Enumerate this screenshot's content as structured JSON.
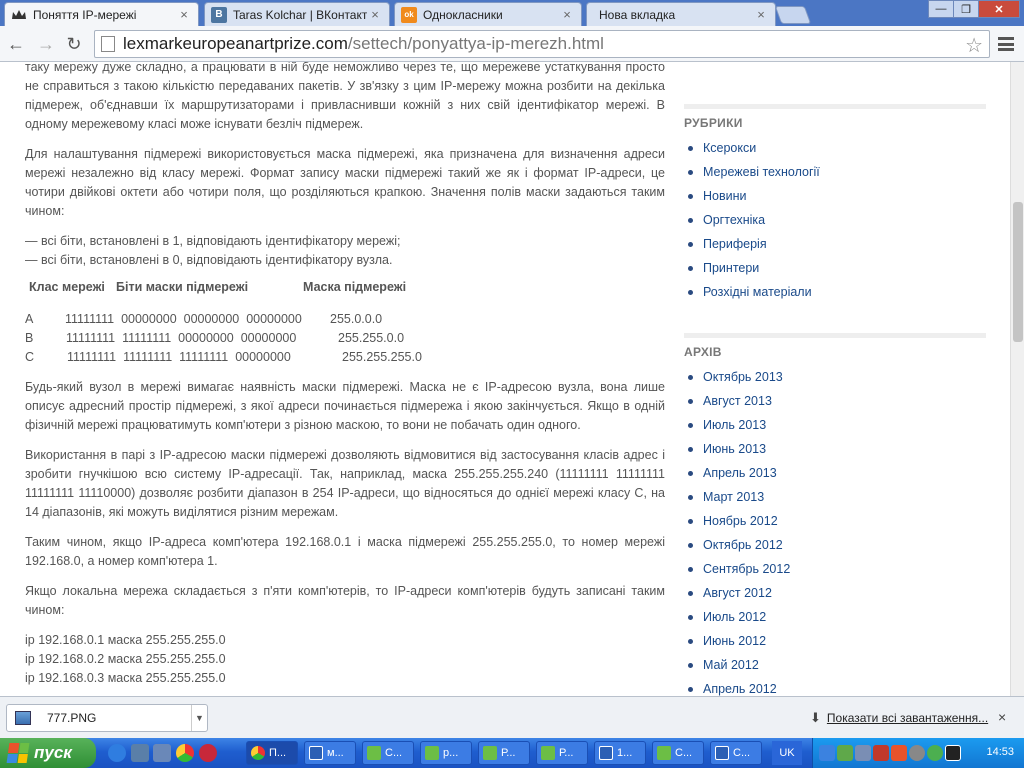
{
  "tabs": [
    {
      "title": "Поняття IP-мережі",
      "close": "×",
      "icon": "crown-icon",
      "active": true
    },
    {
      "title": "Taras Kolchar | ВКонтакті",
      "close": "×",
      "icon": "vk-icon",
      "icon_text": "В",
      "active": false
    },
    {
      "title": "Однокласники",
      "close": "×",
      "icon": "ok-icon",
      "icon_text": "ok",
      "active": false
    },
    {
      "title": "Нова вкладка",
      "close": "×",
      "icon": "new-tab-page-icon",
      "active": false
    }
  ],
  "window_buttons": {
    "minimize": "—",
    "maximize": "❐",
    "close": "✕"
  },
  "toolbar": {
    "back": "←",
    "forward": "→",
    "reload": "↻",
    "star": "☆"
  },
  "address": {
    "host": "lexmarkeuropeanartprize.com",
    "path": "/settech/ponyattya-ip-merezh.html"
  },
  "article": {
    "p1": "таку мережу дуже складно, а працювати в ній буде неможливо через те, що мережеве устаткування просто не справиться з такою кількістю передаваних пакетів. У зв'язку з цим IP-мережу можна розбити на декілька підмереж, об'єднавши їх маршрутизаторами і привласнивши кожній з них свій ідентифікатор мережі. В одному мережевому класі може існувати безліч підмереж.",
    "p2": "Для налаштування підмережі використовується маска підмережі, яка призначена для визначення адреси мережі незалежно від класу мережі. Формат запису маски підмережі такий же як і формат IP-адреси, це чотири двійкові октети або чотири поля, що розділяються крапкою. Значення полів маски задаються таким чином:",
    "bullet1": "— всі біти, встановлені в 1, відповідають ідентифікатору мережі;",
    "bullet2": "— всі біти, встановлені в 0, відповідають ідентифікатору вузла.",
    "p3": "Будь-який вузол в мережі вимагає наявність маски підмережі. Маска не є IP-адресою вузла, вона лише описує адресний простір підмережі, з якої адреси починається підмережа і якою закінчується. Якщо в одній фізичній мережі працюватимуть комп'ютери з різною маскою, то вони не побачать один одного.",
    "p4": "Використання в парі з IP-адресою маски підмережі дозволяють відмовитися від застосування класів адрес і зробити гнучкішою всю систему IP-адресації. Так, наприклад, маска 255.255.255.240 (11111111 11111111 11111111 11110000) дозволяє розбити діапазон в 254 IP-адреси, що відносяться до однієї мережі класу C, на 14 діапазонів, які можуть виділятися різним мережам.",
    "p5": "Таким чином, якщо IP-адреса комп'ютера 192.168.0.1 і маска підмережі 255.255.255.0, то номер мережі 192.168.0, а номер комп'ютера 1.",
    "p6": "Якщо локальна мережа складається з п'яти комп'ютерів, то IP-адреси комп'ютерів будуть записані таким чином:",
    "ips": [
      "ip 192.168.0.1 маска 255.255.255.0",
      "ip 192.168.0.2 маска 255.255.255.0",
      "ip 192.168.0.3 маска 255.255.255.0"
    ]
  },
  "mask_table": {
    "headers": [
      "Клас мережі",
      "Біти маски підмережі",
      "Маска підмережі"
    ],
    "rows": [
      {
        "cls": "A",
        "bits": "11111111  00000000  00000000  00000000",
        "mask": "255.0.0.0"
      },
      {
        "cls": "B",
        "bits": "11111111  11111111  00000000  00000000",
        "mask": "255.255.0.0"
      },
      {
        "cls": "C",
        "bits": "11111111  11111111  11111111  00000000",
        "mask": "255.255.255.0"
      }
    ]
  },
  "sidebar": {
    "rubrics_title": "РУБРИКИ",
    "rubrics": [
      "Ксерокси",
      "Мережеві технології",
      "Новини",
      "Оргтехніка",
      "Периферія",
      "Принтери",
      "Розхідні матеріали"
    ],
    "archive_title": "АРХІВ",
    "archive": [
      "Октябрь 2013",
      "Август 2013",
      "Июль 2013",
      "Июнь 2013",
      "Апрель 2013",
      "Март 2013",
      "Ноябрь 2012",
      "Октябрь 2012",
      "Сентябрь 2012",
      "Август 2012",
      "Июль 2012",
      "Июнь 2012",
      "Май 2012",
      "Апрель 2012"
    ]
  },
  "download_shelf": {
    "file_name": "777.PNG",
    "dropdown": "▼",
    "show_all": "Показати всі завантаження...",
    "close": "×"
  },
  "taskbar": {
    "start_label": "пуск",
    "tasks": [
      {
        "label": "П...",
        "icon": "chrome-icon",
        "active": true
      },
      {
        "label": "м...",
        "icon": "word-icon",
        "active": false
      },
      {
        "label": "С...",
        "icon": "folder-icon",
        "active": false
      },
      {
        "label": "р...",
        "icon": "folder-icon",
        "active": false
      },
      {
        "label": "Р...",
        "icon": "folder-icon",
        "active": false
      },
      {
        "label": "Р...",
        "icon": "folder-icon",
        "active": false
      },
      {
        "label": "1...",
        "icon": "word-icon",
        "active": false
      },
      {
        "label": "С...",
        "icon": "folder-icon",
        "active": false
      },
      {
        "label": "С...",
        "icon": "word-icon",
        "active": false
      }
    ],
    "language": "UK",
    "clock": "14:53"
  }
}
